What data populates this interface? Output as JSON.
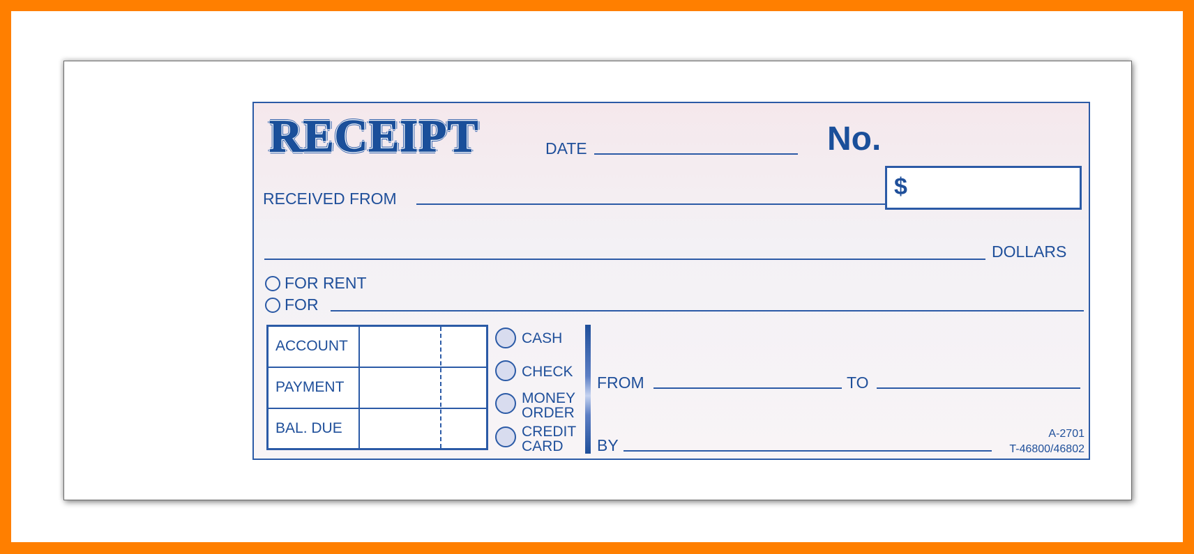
{
  "receipt": {
    "title": "RECEIPT",
    "date_label": "DATE",
    "number_label": "No.",
    "amount_symbol": "$",
    "received_from_label": "RECEIVED FROM",
    "dollars_label": "DOLLARS",
    "purpose_options": [
      {
        "label": "FOR RENT"
      },
      {
        "label": "FOR"
      }
    ],
    "account_table": {
      "rows": [
        {
          "label": "ACCOUNT"
        },
        {
          "label": "PAYMENT"
        },
        {
          "label": "BAL. DUE"
        }
      ]
    },
    "payment_methods": [
      {
        "label_line1": "CASH",
        "label_line2": ""
      },
      {
        "label_line1": "CHECK",
        "label_line2": ""
      },
      {
        "label_line1": "MONEY",
        "label_line2": "ORDER"
      },
      {
        "label_line1": "CREDIT",
        "label_line2": "CARD"
      }
    ],
    "from_label": "FROM",
    "to_label": "TO",
    "by_label": "BY",
    "form_code": "A-2701",
    "catalog_code": "T-46800/46802"
  },
  "colors": {
    "frame": "#ff7f00",
    "ink": "#1f4f9a",
    "paper_tint": "#f5e8ec"
  }
}
